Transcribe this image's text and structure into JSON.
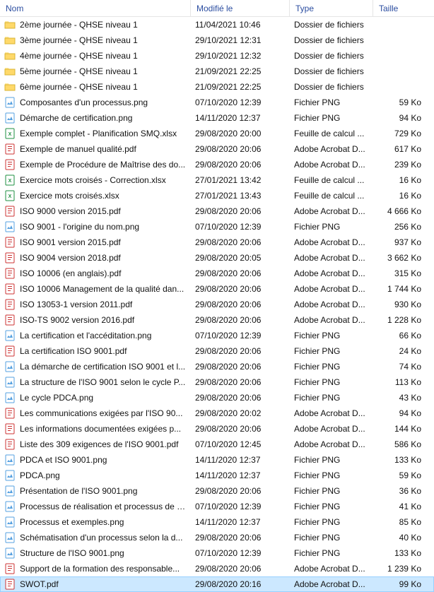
{
  "columns": {
    "name": "Nom",
    "modified": "Modifié le",
    "type": "Type",
    "size": "Taille"
  },
  "rows": [
    {
      "icon": "folder",
      "name": "2ème journée - QHSE niveau 1",
      "modified": "11/04/2021 10:46",
      "type": "Dossier de fichiers",
      "size": ""
    },
    {
      "icon": "folder",
      "name": "3ème journée - QHSE niveau 1",
      "modified": "29/10/2021 12:31",
      "type": "Dossier de fichiers",
      "size": ""
    },
    {
      "icon": "folder",
      "name": "4ème journée - QHSE niveau 1",
      "modified": "29/10/2021 12:32",
      "type": "Dossier de fichiers",
      "size": ""
    },
    {
      "icon": "folder",
      "name": "5ème journée - QHSE niveau 1",
      "modified": "21/09/2021 22:25",
      "type": "Dossier de fichiers",
      "size": ""
    },
    {
      "icon": "folder",
      "name": "6ème journée - QHSE niveau 1",
      "modified": "21/09/2021 22:25",
      "type": "Dossier de fichiers",
      "size": ""
    },
    {
      "icon": "png",
      "name": "Composantes d'un processus.png",
      "modified": "07/10/2020 12:39",
      "type": "Fichier PNG",
      "size": "59 Ko"
    },
    {
      "icon": "png",
      "name": "Démarche de certification.png",
      "modified": "14/11/2020 12:37",
      "type": "Fichier PNG",
      "size": "94 Ko"
    },
    {
      "icon": "xlsx",
      "name": "Exemple complet - Planification SMQ.xlsx",
      "modified": "29/08/2020 20:00",
      "type": "Feuille de calcul ...",
      "size": "729 Ko"
    },
    {
      "icon": "pdf",
      "name": "Exemple de manuel qualité.pdf",
      "modified": "29/08/2020 20:06",
      "type": "Adobe Acrobat D...",
      "size": "617 Ko"
    },
    {
      "icon": "pdf",
      "name": "Exemple de Procédure de Maîtrise des do...",
      "modified": "29/08/2020 20:06",
      "type": "Adobe Acrobat D...",
      "size": "239 Ko"
    },
    {
      "icon": "xlsx",
      "name": "Exercice mots croisés - Correction.xlsx",
      "modified": "27/01/2021 13:42",
      "type": "Feuille de calcul ...",
      "size": "16 Ko"
    },
    {
      "icon": "xlsx",
      "name": "Exercice mots croisés.xlsx",
      "modified": "27/01/2021 13:43",
      "type": "Feuille de calcul ...",
      "size": "16 Ko"
    },
    {
      "icon": "pdf",
      "name": "ISO 9000 version 2015.pdf",
      "modified": "29/08/2020 20:06",
      "type": "Adobe Acrobat D...",
      "size": "4 666 Ko"
    },
    {
      "icon": "png",
      "name": "ISO 9001 - l'origine du nom.png",
      "modified": "07/10/2020 12:39",
      "type": "Fichier PNG",
      "size": "256 Ko"
    },
    {
      "icon": "pdf",
      "name": "ISO 9001 version 2015.pdf",
      "modified": "29/08/2020 20:06",
      "type": "Adobe Acrobat D...",
      "size": "937 Ko"
    },
    {
      "icon": "pdf",
      "name": "ISO 9004 version 2018.pdf",
      "modified": "29/08/2020 20:05",
      "type": "Adobe Acrobat D...",
      "size": "3 662 Ko"
    },
    {
      "icon": "pdf",
      "name": "ISO 10006 (en anglais).pdf",
      "modified": "29/08/2020 20:06",
      "type": "Adobe Acrobat D...",
      "size": "315 Ko"
    },
    {
      "icon": "pdf",
      "name": "ISO 10006 Management de la qualité dan...",
      "modified": "29/08/2020 20:06",
      "type": "Adobe Acrobat D...",
      "size": "1 744 Ko"
    },
    {
      "icon": "pdf",
      "name": "ISO 13053-1 version 2011.pdf",
      "modified": "29/08/2020 20:06",
      "type": "Adobe Acrobat D...",
      "size": "930 Ko"
    },
    {
      "icon": "pdf",
      "name": "ISO-TS 9002 version 2016.pdf",
      "modified": "29/08/2020 20:06",
      "type": "Adobe Acrobat D...",
      "size": "1 228 Ko"
    },
    {
      "icon": "png",
      "name": "La certification et l'accéditation.png",
      "modified": "07/10/2020 12:39",
      "type": "Fichier PNG",
      "size": "66 Ko"
    },
    {
      "icon": "pdf",
      "name": "La certification ISO 9001.pdf",
      "modified": "29/08/2020 20:06",
      "type": "Fichier PNG",
      "size": "24 Ko"
    },
    {
      "icon": "png",
      "name": "La démarche de certification ISO 9001 et l...",
      "modified": "29/08/2020 20:06",
      "type": "Fichier PNG",
      "size": "74 Ko"
    },
    {
      "icon": "png",
      "name": "La structure de l'ISO 9001 selon le cycle P...",
      "modified": "29/08/2020 20:06",
      "type": "Fichier PNG",
      "size": "113 Ko"
    },
    {
      "icon": "png",
      "name": "Le cycle PDCA.png",
      "modified": "29/08/2020 20:06",
      "type": "Fichier PNG",
      "size": "43 Ko"
    },
    {
      "icon": "pdf",
      "name": "Les communications exigées par l'ISO 90...",
      "modified": "29/08/2020 20:02",
      "type": "Adobe Acrobat D...",
      "size": "94 Ko"
    },
    {
      "icon": "pdf",
      "name": "Les informations documentées exigées p...",
      "modified": "29/08/2020 20:06",
      "type": "Adobe Acrobat D...",
      "size": "144 Ko"
    },
    {
      "icon": "pdf",
      "name": "Liste des 309 exigences de l'ISO 9001.pdf",
      "modified": "07/10/2020 12:45",
      "type": "Adobe Acrobat D...",
      "size": "586 Ko"
    },
    {
      "icon": "png",
      "name": "PDCA et ISO 9001.png",
      "modified": "14/11/2020 12:37",
      "type": "Fichier PNG",
      "size": "133 Ko"
    },
    {
      "icon": "png",
      "name": "PDCA.png",
      "modified": "14/11/2020 12:37",
      "type": "Fichier PNG",
      "size": "59 Ko"
    },
    {
      "icon": "png",
      "name": "Présentation de l'ISO 9001.png",
      "modified": "29/08/2020 20:06",
      "type": "Fichier PNG",
      "size": "36 Ko"
    },
    {
      "icon": "png",
      "name": "Processus de réalisation et processus de s...",
      "modified": "07/10/2020 12:39",
      "type": "Fichier PNG",
      "size": "41 Ko"
    },
    {
      "icon": "png",
      "name": "Processus et exemples.png",
      "modified": "14/11/2020 12:37",
      "type": "Fichier PNG",
      "size": "85 Ko"
    },
    {
      "icon": "png",
      "name": "Schématisation d'un processus selon la d...",
      "modified": "29/08/2020 20:06",
      "type": "Fichier PNG",
      "size": "40 Ko"
    },
    {
      "icon": "png",
      "name": "Structure de l'ISO 9001.png",
      "modified": "07/10/2020 12:39",
      "type": "Fichier PNG",
      "size": "133 Ko"
    },
    {
      "icon": "pdf",
      "name": "Support de la formation des responsable...",
      "modified": "29/08/2020 20:06",
      "type": "Adobe Acrobat D...",
      "size": "1 239 Ko"
    },
    {
      "icon": "pdf",
      "name": "SWOT.pdf",
      "modified": "29/08/2020 20:16",
      "type": "Adobe Acrobat D...",
      "size": "99 Ko",
      "selected": true
    }
  ]
}
